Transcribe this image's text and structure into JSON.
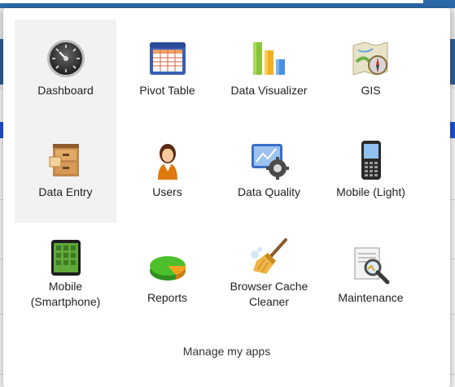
{
  "apps_menu": {
    "items": [
      {
        "label": "Dashboard",
        "icon": "dashboard-gauge-icon",
        "selected": true
      },
      {
        "label": "Pivot Table",
        "icon": "pivot-table-icon"
      },
      {
        "label": "Data Visualizer",
        "icon": "bar-chart-icon"
      },
      {
        "label": "GIS",
        "icon": "map-compass-icon"
      },
      {
        "label": "Data Entry",
        "icon": "filing-cabinet-icon",
        "selected": true
      },
      {
        "label": "Users",
        "icon": "user-icon"
      },
      {
        "label": "Data Quality",
        "icon": "data-quality-gear-icon"
      },
      {
        "label": "Mobile (Light)",
        "icon": "feature-phone-icon"
      },
      {
        "label": "Mobile\n(Smartphone)",
        "icon": "smartphone-icon"
      },
      {
        "label": "Reports",
        "icon": "pie-chart-icon"
      },
      {
        "label": "Browser Cache\nCleaner",
        "icon": "broom-icon"
      },
      {
        "label": "Maintenance",
        "icon": "maintenance-magnifier-icon"
      }
    ],
    "manage_label": "Manage my apps"
  },
  "colors": {
    "top_bar": "#2b6aa8",
    "band": "#2d5f95",
    "blue_strip": "#1f4fd6"
  }
}
